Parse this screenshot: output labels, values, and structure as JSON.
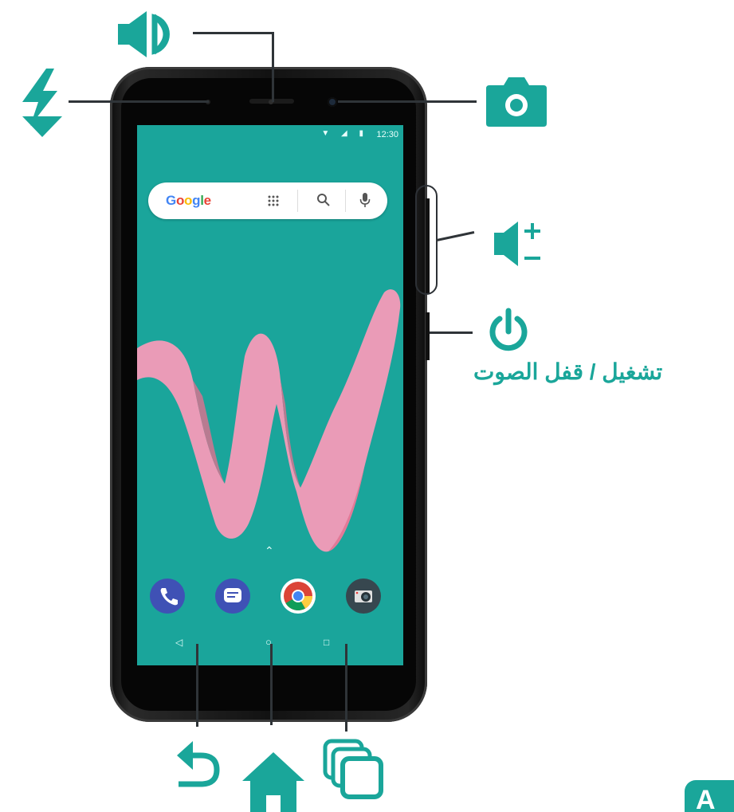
{
  "status_bar": {
    "time": "12:30",
    "icons": "▼ ◢ ▮"
  },
  "search": {
    "logo": [
      "G",
      "o",
      "o",
      "g",
      "l",
      "e"
    ]
  },
  "labels": {
    "power_lock": "تشغيل / قفل الصوت"
  },
  "page_tab": "A",
  "colors": {
    "accent": "#1aa69a",
    "screen": "#1aa59b",
    "ribbon": "#f59ab8"
  },
  "icons": {
    "earpiece": "speaker-icon",
    "sensor": "flash-bolt-icon",
    "front_camera": "camera-icon",
    "volume": "volume-plus-minus-icon",
    "power": "power-icon",
    "back": "back-arrow-icon",
    "home": "home-icon",
    "recents": "recents-icon"
  }
}
